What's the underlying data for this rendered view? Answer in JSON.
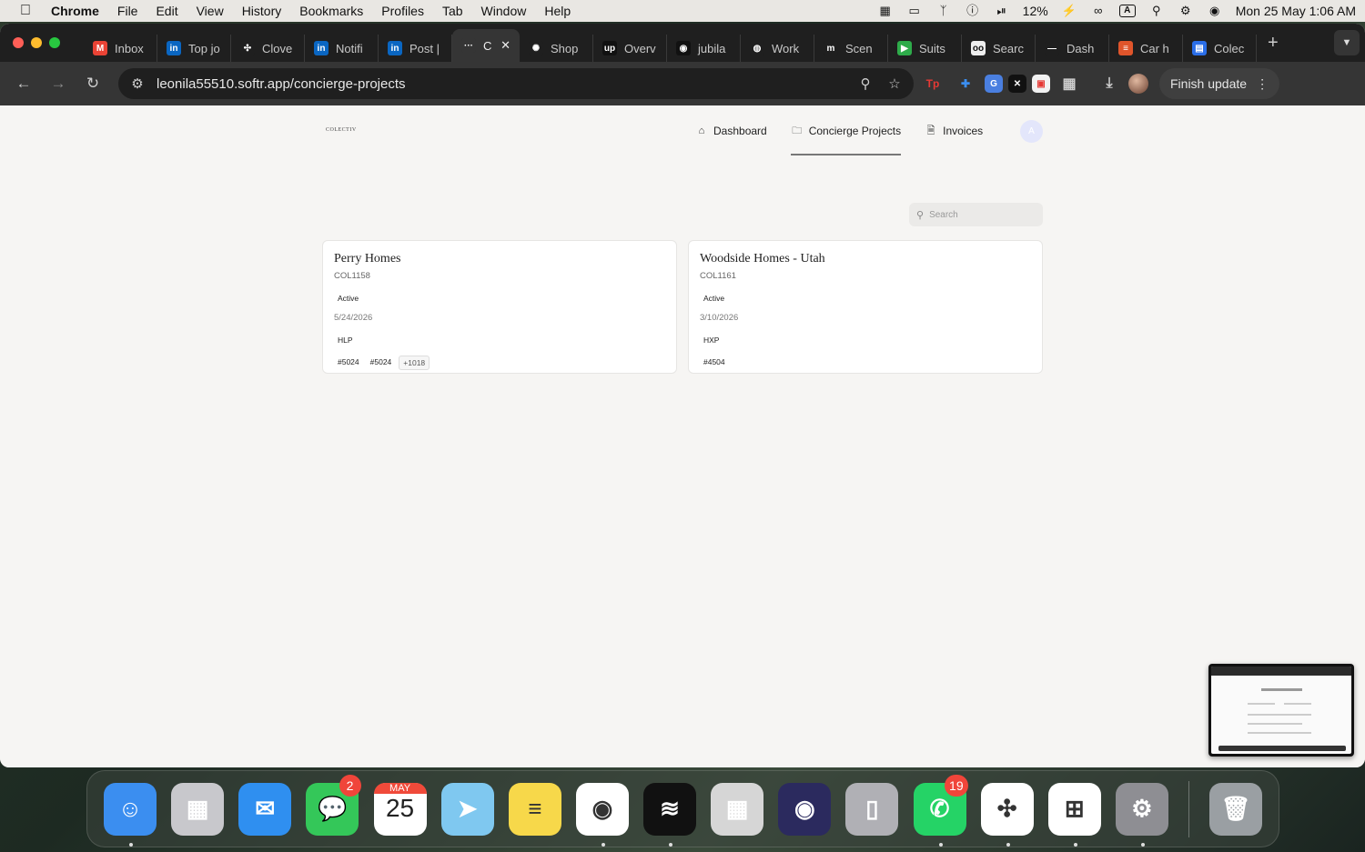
{
  "menubar": {
    "app_name": "Chrome",
    "menus": [
      "File",
      "Edit",
      "View",
      "History",
      "Bookmarks",
      "Profiles",
      "Tab",
      "Window",
      "Help"
    ],
    "battery": "12%",
    "input_source": "A",
    "datetime": "Mon 25 May  1:06 AM"
  },
  "tabs": [
    {
      "label": "Inbox",
      "icon": "gmail-icon",
      "color": "#ea4335",
      "glyph": "M"
    },
    {
      "label": "Top jo",
      "icon": "linkedin-icon",
      "color": "#0a66c2",
      "glyph": "in"
    },
    {
      "label": "Clove",
      "icon": "clover-icon",
      "color": "#1f1f1f",
      "glyph": "✣"
    },
    {
      "label": "Notifi",
      "icon": "linkedin-icon",
      "color": "#0a66c2",
      "glyph": "in"
    },
    {
      "label": "Post |",
      "icon": "linkedin-icon",
      "color": "#0a66c2",
      "glyph": "in"
    },
    {
      "label": "C",
      "icon": "softr-icon",
      "color": "#353535",
      "glyph": "···",
      "active": true
    },
    {
      "label": "Shop",
      "icon": "claude-icon",
      "color": "#1f1f1f",
      "glyph": "✺"
    },
    {
      "label": "Overv",
      "icon": "upwork-icon",
      "color": "#111111",
      "glyph": "up"
    },
    {
      "label": "jubila",
      "icon": "record-icon",
      "color": "#111111",
      "glyph": "◉"
    },
    {
      "label": "Work",
      "icon": "globe-icon",
      "color": "#1f1f1f",
      "glyph": "◍"
    },
    {
      "label": "Scen",
      "icon": "make-icon",
      "color": "#1f1f1f",
      "glyph": "m"
    },
    {
      "label": "Suits",
      "icon": "play-icon",
      "color": "#2eab4a",
      "glyph": "▶"
    },
    {
      "label": "Searc",
      "icon": "search-app-icon",
      "color": "#eeeeee",
      "glyph": "oo"
    },
    {
      "label": "Dash",
      "icon": "dash-icon",
      "color": "#1f1f1f",
      "glyph": "—"
    },
    {
      "label": "Car h",
      "icon": "car-icon",
      "color": "#e0552b",
      "glyph": "≡"
    },
    {
      "label": "Colec",
      "icon": "docs-icon",
      "color": "#2a6ee8",
      "glyph": "▤"
    }
  ],
  "toolbar": {
    "url": "leonila55510.softr.app/concierge-projects",
    "finish_update": "Finish update"
  },
  "page": {
    "logo_text": "COLECTIV",
    "nav": [
      {
        "label": "Dashboard",
        "icon": "home-icon"
      },
      {
        "label": "Concierge Projects",
        "icon": "folder-icon",
        "active": true
      },
      {
        "label": "Invoices",
        "icon": "document-icon"
      }
    ],
    "user_initial": "A",
    "search_placeholder": "Search",
    "cards": [
      {
        "title": "Perry Homes",
        "code": "COL1158",
        "status": "Active",
        "date": "5/24/2026",
        "tag": "HLP",
        "chips": [
          "#5024",
          "#5024"
        ],
        "more": "+1018"
      },
      {
        "title": "Woodside Homes - Utah",
        "code": "COL1161",
        "status": "Active",
        "date": "3/10/2026",
        "tag": "HXP",
        "chips": [
          "#4504"
        ],
        "more": ""
      }
    ]
  },
  "dock": [
    {
      "name": "finder",
      "color": "#3b8ef0",
      "glyph": "☺"
    },
    {
      "name": "launchpad",
      "color": "#c8c8cc",
      "glyph": "▦"
    },
    {
      "name": "mail",
      "color": "#2f8ff0",
      "glyph": "✉"
    },
    {
      "name": "messages",
      "color": "#34c759",
      "glyph": "💬",
      "badge": "2"
    },
    {
      "name": "calendar",
      "color": "#ffffff",
      "glyph": "25",
      "month": "MAY"
    },
    {
      "name": "maps",
      "color": "#7fc8f0",
      "glyph": "➤"
    },
    {
      "name": "notes",
      "color": "#f7d84a",
      "glyph": "≡"
    },
    {
      "name": "chrome",
      "color": "#ffffff",
      "glyph": "◉"
    },
    {
      "name": "spotify",
      "color": "#111111",
      "glyph": "≋"
    },
    {
      "name": "calculator",
      "color": "#d6d6d6",
      "glyph": "▦"
    },
    {
      "name": "firefox",
      "color": "#2b2a5e",
      "glyph": "◉"
    },
    {
      "name": "iphone-mirroring",
      "color": "#b0b0b5",
      "glyph": "▯"
    },
    {
      "name": "whatsapp",
      "color": "#25d366",
      "glyph": "✆",
      "badge": "19"
    },
    {
      "name": "slack",
      "color": "#ffffff",
      "glyph": "✣"
    },
    {
      "name": "windows-app",
      "color": "#ffffff",
      "glyph": "⊞"
    },
    {
      "name": "system-settings",
      "color": "#8e8e93",
      "glyph": "⚙"
    },
    {
      "name": "trash",
      "color": "#9a9fa3",
      "glyph": "🗑"
    }
  ]
}
